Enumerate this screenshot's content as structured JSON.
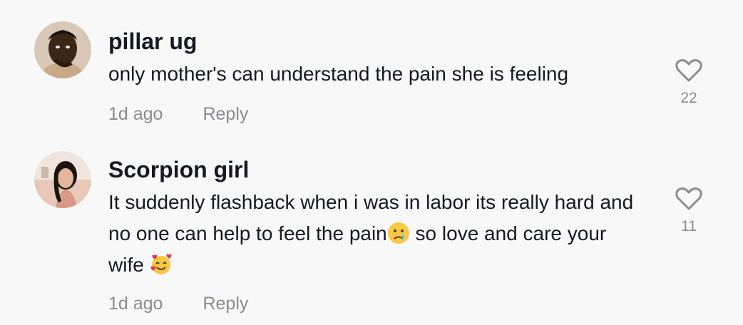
{
  "comments": [
    {
      "username": "pillar ug",
      "text": "only mother's can understand the pain she is feeling",
      "time": "1d ago",
      "reply_label": "Reply",
      "likes": "22",
      "avatar_icon": "user-avatar-photo"
    },
    {
      "username": "Scorpion girl",
      "text_part1": "It suddenly flashback when i was in labor its really hard and no one can help to feel the pain",
      "emoji1": "crying-face-emoji",
      "text_part2": " so love and care your wife ",
      "emoji2": "smiling-face-with-hearts-emoji",
      "time": "1d ago",
      "reply_label": "Reply",
      "likes": "11",
      "avatar_icon": "user-avatar-photo"
    }
  ],
  "colors": {
    "background": "#f8f8f8",
    "text_primary": "#161823",
    "text_secondary": "#8a8b91"
  }
}
